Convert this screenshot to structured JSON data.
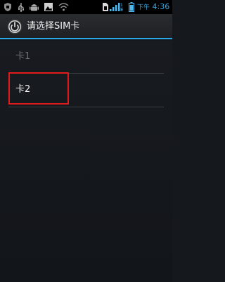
{
  "status_bar": {
    "icons": [
      "shield-icon",
      "usb-icon",
      "android-debug-icon",
      "image-icon",
      "wifi-icon",
      "sim-icon",
      "signal-icon",
      "network-icon",
      "battery-icon"
    ],
    "ampm": "下午",
    "time": "4:36",
    "accent": "#38a6e0"
  },
  "header": {
    "app_icon": "power-icon",
    "title": "请选择SIM卡",
    "accent": "#2aa7e6"
  },
  "sim_list": {
    "items": [
      {
        "label": "卡1",
        "enabled": false
      },
      {
        "label": "卡2",
        "enabled": true
      }
    ],
    "highlight_color": "#e01b1b"
  }
}
